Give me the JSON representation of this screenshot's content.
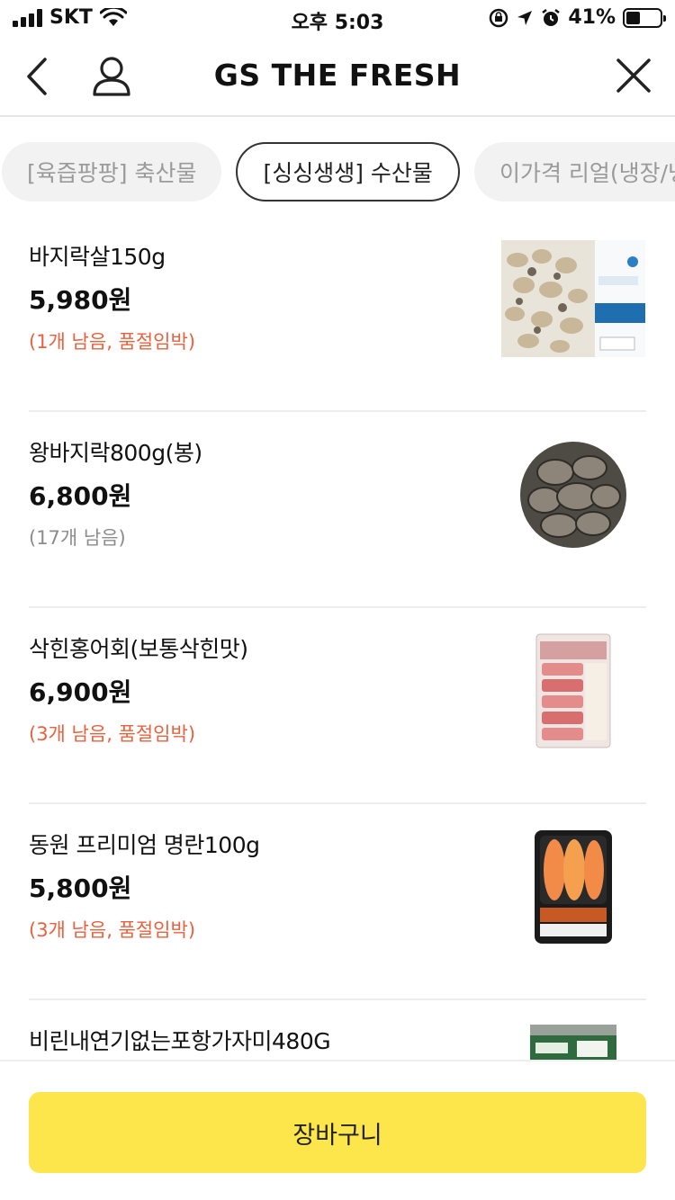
{
  "status_bar": {
    "carrier": "SKT",
    "time": "오후 5:03",
    "battery": "41%",
    "battery_level": 0.41
  },
  "nav": {
    "title": "GS THE FRESH"
  },
  "tabs": [
    {
      "label": "[육즙팡팡] 축산물",
      "active": false
    },
    {
      "label": "[싱싱생생] 수산물",
      "active": true
    },
    {
      "label": "이가격 리얼(냉장/냉",
      "active": false
    }
  ],
  "products": [
    {
      "name": "바지락살150g",
      "price": "5,980원",
      "stock": "(1개 남음, 품절임박)",
      "urgent": true,
      "image": "clam-meat-package"
    },
    {
      "name": "왕바지락800g(봉)",
      "price": "6,800원",
      "stock": "(17개 남음)",
      "urgent": false,
      "image": "clams-bowl"
    },
    {
      "name": "삭힌홍어회(보통삭힌맛)",
      "price": "6,900원",
      "stock": "(3개 남음, 품절임박)",
      "urgent": true,
      "image": "skate-sashimi-package"
    },
    {
      "name": "동원 프리미엄 명란100g",
      "price": "5,800원",
      "stock": "(3개 남음, 품절임박)",
      "urgent": true,
      "image": "pollock-roe-tray"
    },
    {
      "name": "비린내연기없는포항가자미480G",
      "price": "",
      "stock": "",
      "urgent": false,
      "image": "flounder-package"
    }
  ],
  "bottom": {
    "cart_label": "장바구니"
  },
  "colors": {
    "accent_yellow": "#fde54c",
    "urgent_red": "#e8623f",
    "muted_gray": "#8c8c8c"
  }
}
